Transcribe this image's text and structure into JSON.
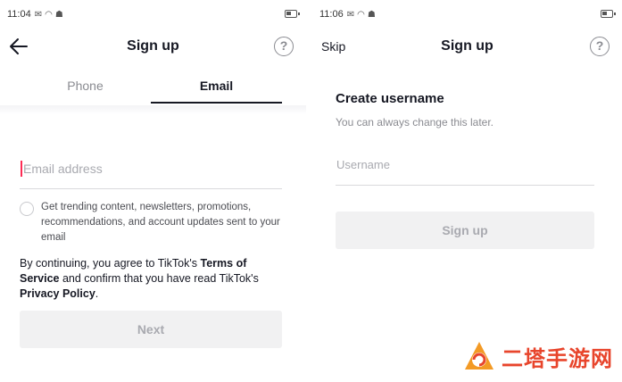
{
  "left_screen": {
    "status": {
      "time": "11:04"
    },
    "header": {
      "title": "Sign up"
    },
    "tabs": [
      {
        "label": "Phone"
      },
      {
        "label": "Email"
      }
    ],
    "email_input": {
      "placeholder": "Email address",
      "value": ""
    },
    "consent_text": "Get trending content, newsletters, promotions, recommendations, and account updates sent to your email",
    "legal": {
      "part1": "By continuing, you agree to TikTok's ",
      "terms": "Terms of Service",
      "part2": " and confirm that you have read TikTok's ",
      "privacy": "Privacy Policy",
      "part3": "."
    },
    "next_label": "Next"
  },
  "right_screen": {
    "status": {
      "time": "11:06"
    },
    "header": {
      "title": "Sign up",
      "skip_label": "Skip"
    },
    "create_title": "Create username",
    "create_subtitle": "You can always change this later.",
    "username_input": {
      "placeholder": "Username",
      "value": ""
    },
    "signup_label": "Sign up"
  },
  "watermark": {
    "text": "二塔手游网"
  },
  "colors": {
    "accent": "#fe2c55",
    "disabled_bg": "#f1f1f2",
    "watermark": "#e8452c"
  }
}
